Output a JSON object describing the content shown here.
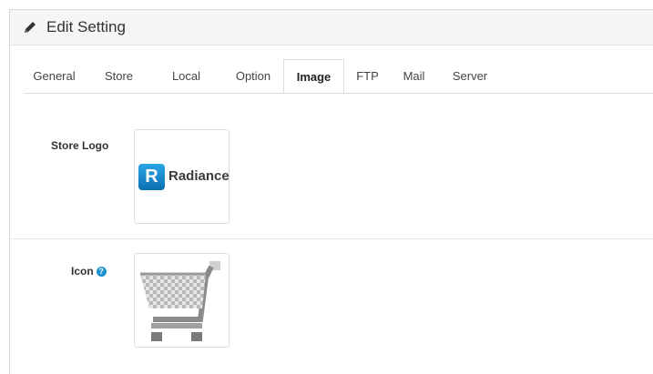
{
  "panel": {
    "title": "Edit Setting"
  },
  "tabs": [
    {
      "label": "General",
      "active": false
    },
    {
      "label": "Store",
      "active": false
    },
    {
      "label": "Local",
      "active": false
    },
    {
      "label": "Option",
      "active": false
    },
    {
      "label": "Image",
      "active": true
    },
    {
      "label": "FTP",
      "active": false
    },
    {
      "label": "Mail",
      "active": false
    },
    {
      "label": "Server",
      "active": false
    }
  ],
  "form": {
    "store_logo": {
      "label": "Store Logo",
      "logo_letter": "R",
      "logo_text": "Radiance"
    },
    "icon": {
      "label": "Icon",
      "help_glyph": "?"
    }
  },
  "icons": {
    "heading": "pencil-icon",
    "help": "question-circle-icon",
    "favicon": "shopping-cart-icon"
  },
  "colors": {
    "accent": "#1e91cf",
    "logo_blue": "#0b6fb0"
  }
}
